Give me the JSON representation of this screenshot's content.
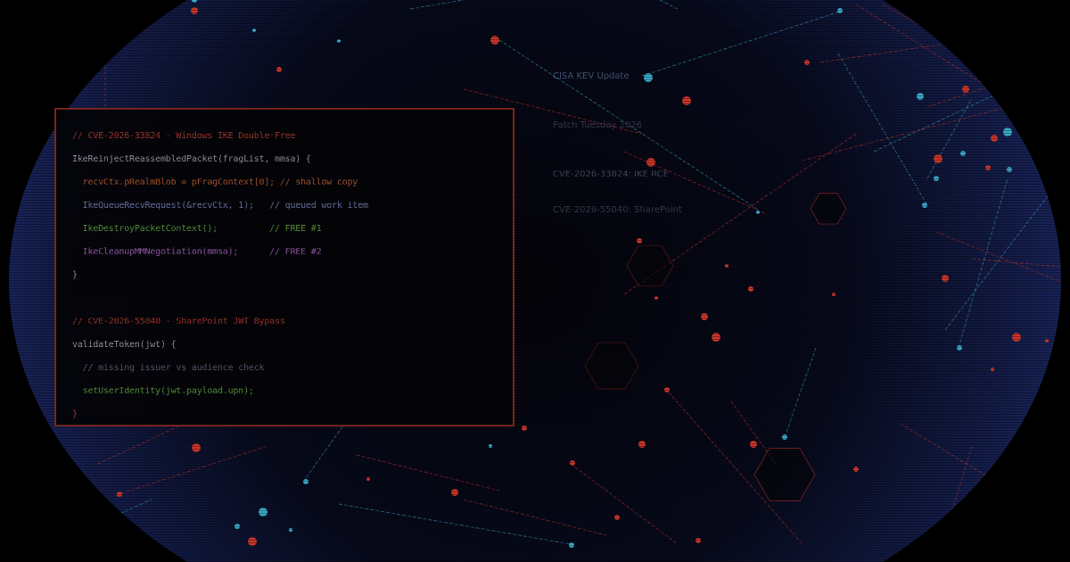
{
  "code_panel": {
    "lines": [
      {
        "text": "// CVE-2026-33824 - Windows IKE Double-Free",
        "style": "comment-red"
      },
      {
        "text": "IkeReinjectReassembledPacket(fragList, mmsa) {",
        "style": "plain"
      },
      {
        "text": "  recvCtx.pRealmBlob = pFragContext[0]; // shallow copy",
        "style": "orange"
      },
      {
        "text": "  IkeQueueRecvRequest(&recvCtx, 1);   // queued work item",
        "style": "blue"
      },
      {
        "text": "  IkeDestroyPacketContext();          // FREE #1",
        "style": "green"
      },
      {
        "text": "  IkeCleanupMMNegotiation(mmsa);      // FREE #2",
        "style": "purple"
      },
      {
        "text": "}",
        "style": "plain"
      },
      {
        "text": "",
        "style": "plain"
      },
      {
        "text": "// CVE-2026-55040 - SharePoint JWT Bypass",
        "style": "comment-red"
      },
      {
        "text": "validateToken(jwt) {",
        "style": "plain"
      },
      {
        "text": "  // missing issuer vs audience check",
        "style": "dim"
      },
      {
        "text": "  setUserIdentity(jwt.payload.upn);",
        "style": "green"
      },
      {
        "text": "}",
        "style": "red"
      }
    ]
  },
  "labels": {
    "kev_update": "CISA KEV Update",
    "patch_day": "Patch Tuesday 2026",
    "cve_ike": "CVE-2026-33824: IKE RCE",
    "cve_sharepoint": "CVE-2026-55040: SharePoint"
  },
  "colors": {
    "red": "#c9362a",
    "cyan": "#3aa9c9",
    "navy": "#1a2a66"
  }
}
